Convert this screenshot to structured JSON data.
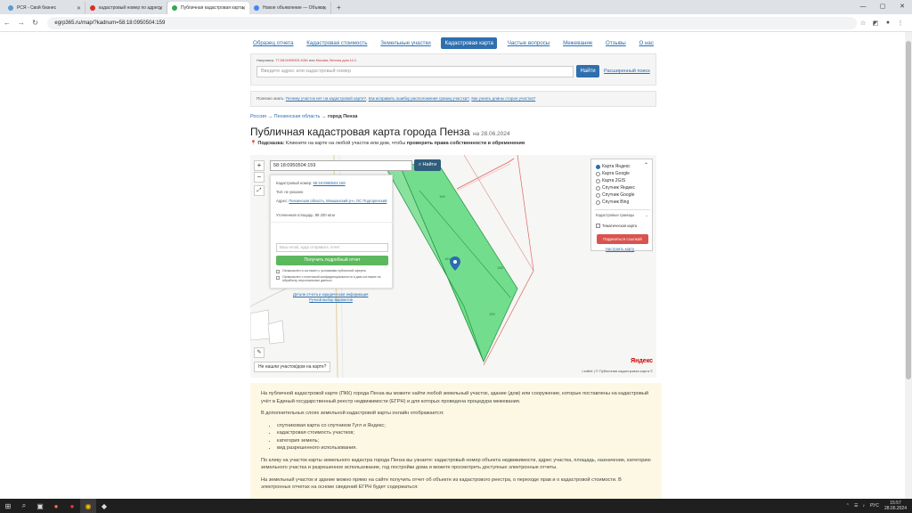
{
  "browser": {
    "tabs": [
      {
        "label": "РСЯ - Свой бизнес",
        "color": "#5b9bd5",
        "active": false
      },
      {
        "label": "кадастровый номер по адресу",
        "color": "#d93025",
        "active": false
      },
      {
        "label": "Публичная кадастровая карта",
        "color": "#34a853",
        "active": true
      },
      {
        "label": "Новое объявление — Объявл",
        "color": "#4285f4",
        "active": false
      }
    ],
    "new_tab": "+",
    "url": "egrp365.ru/map/?kadnum=58:18:0950504:159",
    "back": "←",
    "forward": "→",
    "reload": "↻",
    "minimize": "—",
    "maximize": "▢",
    "close": "✕"
  },
  "topnav": {
    "items": [
      {
        "label": "Образец отчета",
        "active": false
      },
      {
        "label": "Кадастровая стоимость",
        "active": false
      },
      {
        "label": "Земельные участки",
        "active": false
      },
      {
        "label": "Кадастровая карта",
        "active": true
      },
      {
        "label": "Частые вопросы",
        "active": false
      },
      {
        "label": "Межевание",
        "active": false
      },
      {
        "label": "Отзывы",
        "active": false
      },
      {
        "label": "О нас",
        "active": false
      }
    ]
  },
  "search": {
    "hint_prefix": "Например:",
    "hint_example1": "77:08:0009005:1156",
    "hint_or": "или",
    "hint_example2": "Москва Ленина дом 11/1",
    "placeholder": "Введите адрес или кадастровый номер",
    "button": "Найти",
    "advanced": "Расширенный поиск"
  },
  "useful": {
    "prefix": "Полезно знать:",
    "links": [
      "Почему участок нет на кадастровой карте?",
      "Как исправить ошибку расположения границ участка?",
      "Как узнать длины сторон участка?"
    ]
  },
  "breadcrumbs": {
    "items": [
      "Россия",
      "Пензенская область"
    ],
    "sep": "→",
    "current": "город Пенза"
  },
  "page": {
    "title": "Публичная кадастровая карта города Пенза",
    "date": "на 28.06.2024",
    "tip_label": "Подсказка:",
    "tip_text": "Кликните на карте на любой участок или дом, чтобы",
    "tip_bold": "проверить права собственности и обременения"
  },
  "map": {
    "search_value": "58:18:0950504:159",
    "search_button": "Найти",
    "zoom_in": "+",
    "zoom_out": "−",
    "popup": {
      "kad_label": "Кадастровый номер:",
      "kad_value": "58:18:0950504:159",
      "type_label": "Тип:",
      "type_value": "не указано",
      "addr_label": "Адрес:",
      "addr_value": "Пензенская область, Мокшанский р-н, ОС Подгоренский",
      "area_label": "Уточненная площадь:",
      "area_value": "88 200 кв.м",
      "email_placeholder": "Ваш email, куда отправить отчет",
      "report_button": "Получить подробный отчет",
      "consent1": "Ознакомлен и согласен с условиями публичной оферты",
      "consent2": "Ознакомлен с политикой конфиденциальности и даю согласие на обработку персональных данных",
      "details_link": "Детали отчета и юридическая информация",
      "manual_link": "Ручной выбор вариантов"
    },
    "layers": {
      "options": [
        {
          "label": "Карта Яндекс",
          "on": true
        },
        {
          "label": "Карта Google",
          "on": false
        },
        {
          "label": "Карта 2GIS",
          "on": false
        },
        {
          "label": "Спутник Яндекс",
          "on": false
        },
        {
          "label": "Спутник Google",
          "on": false
        },
        {
          "label": "Спутник Bing",
          "on": false
        }
      ],
      "borders": "Кадастровые границы",
      "thematic": "Тематическая карта",
      "share_button": "Поделиться ссылкой",
      "settings_link": "Настроить карту"
    },
    "not_found": "Не нашли участок/дом на карте?",
    "parcel_labels": [
      "159",
      "163",
      "158",
      "159"
    ],
    "yandex": "Яндекс",
    "license": "Leaflet | © Публичная кадастровая карта ©"
  },
  "info": {
    "p1": "На публичной кадастровой карте (ПКК) города Пенза вы можете найти любой земельный участок, здание (дом) или сооружение, которые поставлены на кадастровый учёт в Единый государственный реестр недвижимости (ЕГРН) и для которых проведена процедура межевания.",
    "p2": "В дополнительных слоях земельной кадастровой карты онлайн отображается:",
    "list": [
      "спутниковая карта со спутников Гугл и Яндекс;",
      "кадастровая стоимость участков;",
      "категория земель;",
      "вид разрешенного использования."
    ],
    "p3": "По клику на участок карты земельного кадастра города Пенза вы узнаете: кадастровый номер объекта недвижимости, адрес участка, площадь, назначение, категорию земельного участка и разрешенное использование, год постройки дома и можете просмотреть доступные электронные отчеты.",
    "p4": "На земельный участок и здание можно прямо на сайте получить отчет об объекте из кадастрового реестра, о переходе прав и о кадастровой стоимости. В электронных отчетах на основе сведений ЕГРН будет содержаться:"
  },
  "taskbar": {
    "lang": "РУС",
    "time": "15:57",
    "date": "28.06.2024"
  },
  "colors": {
    "accent": "#2f6fae",
    "parcel_fill": "#5bd97a",
    "parcel_stroke": "#2a9a4a",
    "info_bg": "#fcf8e3"
  }
}
